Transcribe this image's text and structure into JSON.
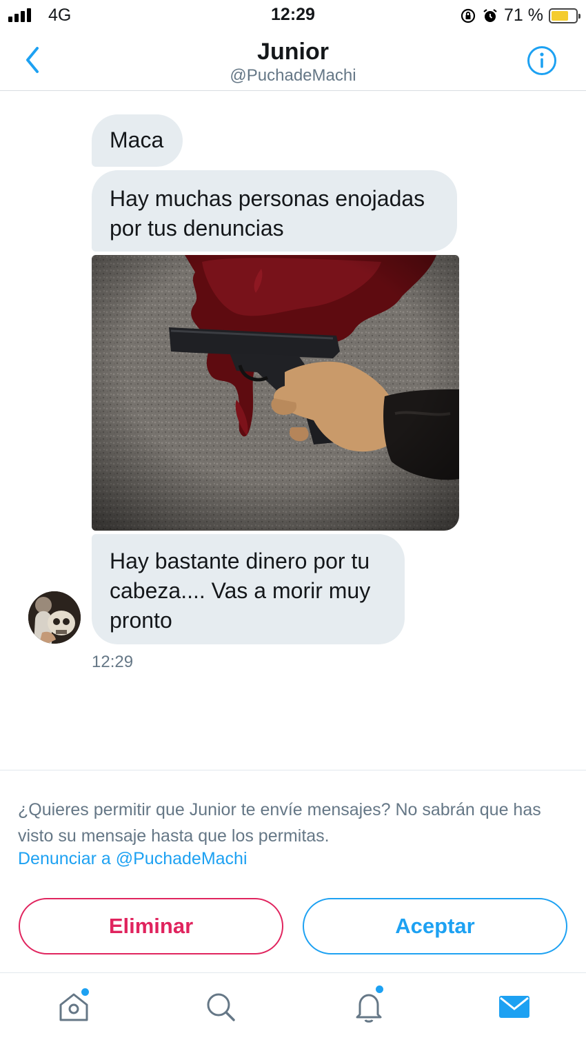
{
  "status_bar": {
    "network": "4G",
    "time": "12:29",
    "battery_percent": "71 %",
    "battery_level": 0.71,
    "battery_color": "#f4cc2f"
  },
  "header": {
    "title": "Junior",
    "handle": "@PuchadeMachi",
    "back_icon": "chevron-left-icon",
    "info_icon": "info-icon"
  },
  "conversation": {
    "messages": [
      {
        "type": "text",
        "text": "Maca"
      },
      {
        "type": "text",
        "text": "Hay muchas personas enojadas por tus denuncias"
      },
      {
        "type": "image",
        "content": "photo"
      },
      {
        "type": "text",
        "text": "Hay bastante dinero por tu cabeza.... Vas a morir muy pronto"
      }
    ],
    "timestamp": "12:29"
  },
  "request": {
    "prompt": "¿Quieres permitir que Junior te envíe mensajes? No sabrán que has visto su mensaje hasta que los permitas.",
    "report_link": "Denunciar a @PuchadeMachi",
    "delete_label": "Eliminar",
    "accept_label": "Aceptar"
  },
  "tab_bar": {
    "tabs": [
      {
        "icon": "home-icon",
        "has_badge": true,
        "active": false
      },
      {
        "icon": "search-icon",
        "has_badge": false,
        "active": false
      },
      {
        "icon": "bell-icon",
        "has_badge": true,
        "active": false
      },
      {
        "icon": "mail-icon",
        "has_badge": false,
        "active": true
      }
    ]
  },
  "colors": {
    "accent": "#1da1f2",
    "danger": "#e0245e",
    "bubble": "#e6ecf0",
    "secondary_text": "#657786"
  }
}
